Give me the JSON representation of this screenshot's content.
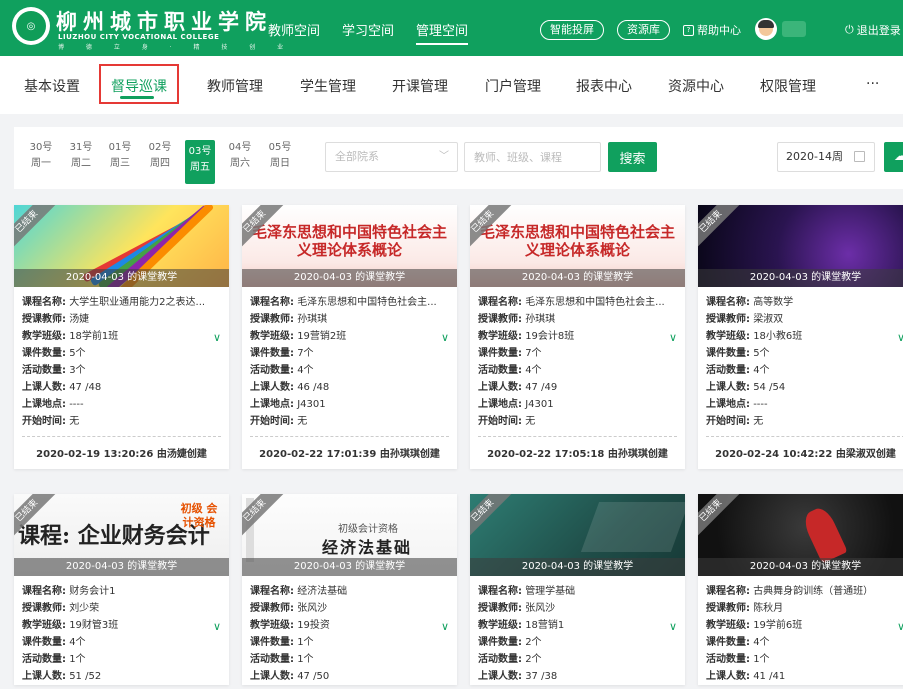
{
  "header": {
    "school_name": "柳州城市职业学院",
    "school_name_en": "LIUZHOU CITY VOCATIONAL COLLEGE",
    "school_motto": "博 德 立 身 · 精 技 创 业",
    "nav": [
      "教师空间",
      "学习空间",
      "管理空间"
    ],
    "active_nav": "管理空间",
    "smart_cast": "智能投屏",
    "resource_lib": "资源库",
    "help": "帮助中心",
    "logout": "退出登录"
  },
  "subnav": {
    "items": [
      "基本设置",
      "督导巡课",
      "教师管理",
      "学生管理",
      "开课管理",
      "门户管理",
      "报表中心",
      "资源中心",
      "权限管理",
      "···"
    ],
    "active": "督导巡课"
  },
  "filter": {
    "days": [
      {
        "date": "30号",
        "weekday": "周一"
      },
      {
        "date": "31号",
        "weekday": "周二"
      },
      {
        "date": "01号",
        "weekday": "周三"
      },
      {
        "date": "02号",
        "weekday": "周四"
      },
      {
        "date": "03号",
        "weekday": "周五"
      },
      {
        "date": "04号",
        "weekday": "周六"
      },
      {
        "date": "05号",
        "weekday": "周日"
      }
    ],
    "active_day": "03号",
    "department": "全部院系",
    "search_placeholder": "教师、班级、课程",
    "search_button": "搜索",
    "week": "2020-14周"
  },
  "labels": {
    "course": "课程名称:",
    "teacher": "授课教师:",
    "class": "教学班级:",
    "courseware": "课件数量:",
    "activity": "活动数量:",
    "attendance": "上课人数:",
    "location": "上课地点:",
    "start": "开始时间:"
  },
  "status_badge": "已结束",
  "cards": [
    {
      "caption": "2020-04-03 的课堂教学",
      "course": "大学生职业通用能力2之表达...",
      "teacher": "汤婕",
      "class": "18学前1班",
      "courseware": "5个",
      "activity": "3个",
      "attendance": "47 /48",
      "location": "----",
      "start": "无",
      "created": "2020-02-19 13:20:26 由汤婕创建"
    },
    {
      "caption": "2020-04-03 的课堂教学",
      "cover_title": "毛泽东思想和中国特色社会主义理论体系概论",
      "course": "毛泽东思想和中国特色社会主...",
      "teacher": "孙琪琪",
      "class": "19营销2班",
      "courseware": "7个",
      "activity": "4个",
      "attendance": "46 /48",
      "location": "J4301",
      "start": "无",
      "created": "2020-02-22 17:01:39 由孙琪琪创建"
    },
    {
      "caption": "2020-04-03 的课堂教学",
      "cover_title": "毛泽东思想和中国特色社会主义理论体系概论",
      "course": "毛泽东思想和中国特色社会主...",
      "teacher": "孙琪琪",
      "class": "19会计8班",
      "courseware": "7个",
      "activity": "4个",
      "attendance": "47 /49",
      "location": "J4301",
      "start": "无",
      "created": "2020-02-22 17:05:18 由孙琪琪创建"
    },
    {
      "caption": "2020-04-03 的课堂教学",
      "course": "高等数学",
      "teacher": "梁淑双",
      "class": "18小教6班",
      "courseware": "5个",
      "activity": "4个",
      "attendance": "54 /54",
      "location": "----",
      "start": "无",
      "created": "2020-02-24 10:42:22 由梁淑双创建"
    },
    {
      "caption": "2020-04-03 的课堂教学",
      "cover_title": "课程: 企业财务会计",
      "cover_badge": "初级 会计资格",
      "course": "财务会计1",
      "teacher": "刘少荣",
      "class": "19财管3班",
      "courseware": "4个",
      "activity": "1个",
      "attendance": "51 /52"
    },
    {
      "caption": "2020-04-03 的课堂教学",
      "cover_title": "经济法基础",
      "cover_badge": "初级会计资格",
      "course": "经济法基础",
      "teacher": "张风沙",
      "class": "19投资",
      "courseware": "1个",
      "activity": "1个",
      "attendance": "47 /50"
    },
    {
      "caption": "2020-04-03 的课堂教学",
      "course": "管理学基础",
      "teacher": "张风沙",
      "class": "18营销1",
      "courseware": "2个",
      "activity": "2个",
      "attendance": "37 /38"
    },
    {
      "caption": "2020-04-03 的课堂教学",
      "course": "古典舞身韵训练（普通班）",
      "teacher": "陈秋月",
      "class": "19学前6班",
      "courseware": "4个",
      "activity": "1个",
      "attendance": "41 /41"
    }
  ]
}
